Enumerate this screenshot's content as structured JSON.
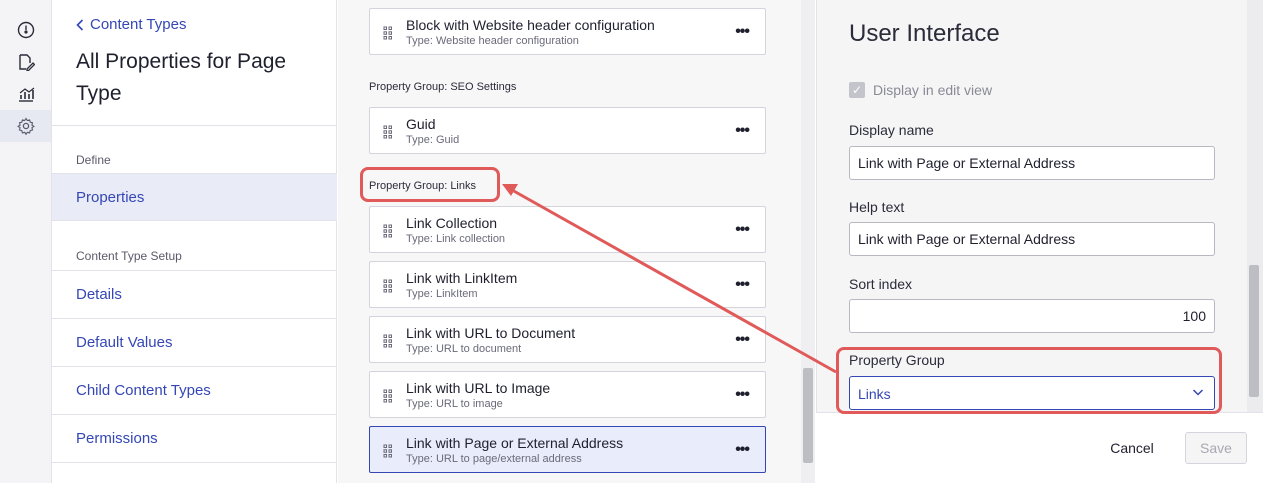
{
  "rail": {
    "items": [
      {
        "icon": "dashboard-icon"
      },
      {
        "icon": "edit-icon"
      },
      {
        "icon": "reports-icon"
      },
      {
        "icon": "settings-icon",
        "active": true
      }
    ]
  },
  "nav": {
    "back_label": "Content Types",
    "title": "All Properties for Page Type",
    "section_define": "Define",
    "properties_label": "Properties",
    "section_setup": "Content Type Setup",
    "items": [
      "Details",
      "Default Values",
      "Child Content Types",
      "Permissions"
    ]
  },
  "middle": {
    "top_card": {
      "name": "Block with Website header configuration",
      "type": "Type: Website header configuration"
    },
    "seo_group": "Property Group: SEO Settings",
    "guid_card": {
      "name": "Guid",
      "type": "Type: Guid"
    },
    "links_group": "Property Group: Links",
    "link_cards": [
      {
        "name": "Link Collection",
        "type": "Type: Link collection"
      },
      {
        "name": "Link with LinkItem",
        "type": "Type: LinkItem"
      },
      {
        "name": "Link with URL to Document",
        "type": "Type: URL to document"
      },
      {
        "name": "Link with URL to Image",
        "type": "Type: URL to image"
      },
      {
        "name": "Link with Page or External Address",
        "type": "Type: URL to page/external address",
        "selected": true
      }
    ]
  },
  "panel": {
    "title": "User Interface",
    "display_in_edit_view": "Display in edit view",
    "display_name_label": "Display name",
    "display_name_value": "Link with Page or External Address",
    "help_text_label": "Help text",
    "help_text_value": "Link with Page or External Address",
    "sort_index_label": "Sort index",
    "sort_index_value": "100",
    "property_group_label": "Property Group",
    "property_group_value": "Links",
    "cancel_label": "Cancel",
    "save_label": "Save"
  },
  "colors": {
    "accent": "#3447b5",
    "highlight": "#e05a5a"
  }
}
